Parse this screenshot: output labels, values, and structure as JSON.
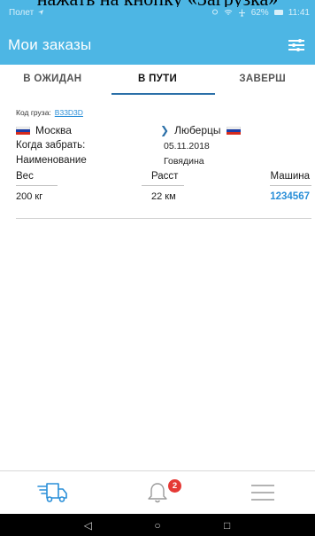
{
  "overlay_caption": "нажать на кнопку «Загрузка»",
  "statusbar": {
    "left": "Полет",
    "battery": "62%",
    "time": "11:41"
  },
  "appbar": {
    "title": "Мои заказы",
    "filter_icon": "filter-sliders-icon"
  },
  "tabs": [
    {
      "label": "В ОЖИДАН",
      "active": false
    },
    {
      "label": "В ПУТИ",
      "active": true
    },
    {
      "label": "ЗАВЕРШ",
      "active": false
    }
  ],
  "cargo": {
    "code_label": "Код груза:",
    "code_value": "B33D3D",
    "from_city": "Москва",
    "to_city": "Люберцы",
    "pickup_label": "Когда забрать:",
    "pickup_value": "05.11.2018",
    "name_label": "Наименование",
    "name_value": "Говядина",
    "col_weight": "Вес",
    "col_distance": "Расст",
    "col_vehicle": "Машина",
    "weight": "200 кг",
    "distance": "22 км",
    "vehicle": "1234567"
  },
  "bottom_nav": {
    "items": [
      {
        "icon": "truck-icon"
      },
      {
        "icon": "bell-icon",
        "badge": "2"
      },
      {
        "icon": "menu-icon"
      }
    ]
  },
  "colors": {
    "primary": "#4db6e4",
    "tab_indicator": "#2a6fa8",
    "link": "#2a8fd8",
    "badge": "#e53935"
  }
}
